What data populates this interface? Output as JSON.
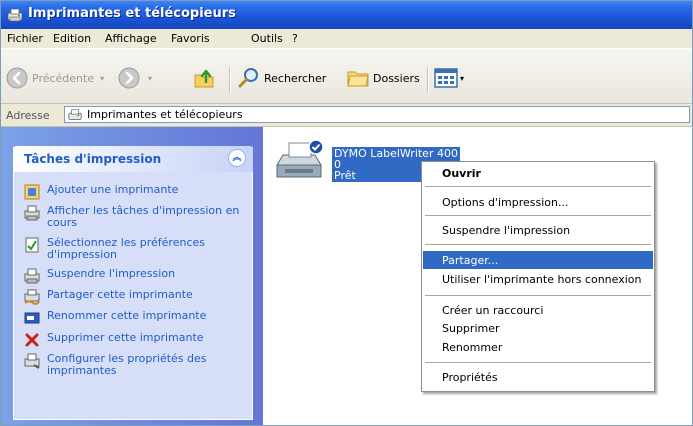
{
  "window": {
    "title": "Imprimantes et télécopieurs"
  },
  "menu": [
    "Fichier",
    "Edition",
    "Affichage",
    "Favoris",
    "Outils",
    "?"
  ],
  "toolbar": {
    "back": "Précédente",
    "search": "Rechercher",
    "folders": "Dossiers"
  },
  "address": {
    "label": "Adresse",
    "value": "Imprimantes et télécopieurs"
  },
  "tasks": {
    "title": "Tâches d'impression",
    "items": [
      {
        "label": "Ajouter une imprimante",
        "icon": "add-printer-icon"
      },
      {
        "label": "Afficher les tâches d'impression en cours",
        "icon": "print-queue-icon"
      },
      {
        "label": "Sélectionnez les préférences d'impression",
        "icon": "preferences-icon"
      },
      {
        "label": "Suspendre l'impression",
        "icon": "pause-printer-icon"
      },
      {
        "label": "Partager cette imprimante",
        "icon": "share-printer-icon"
      },
      {
        "label": "Renommer cette imprimante",
        "icon": "rename-icon"
      },
      {
        "label": "Supprimer cette imprimante",
        "icon": "delete-icon"
      },
      {
        "label": "Configurer les propriétés des imprimantes",
        "icon": "properties-icon"
      }
    ]
  },
  "printer": {
    "name": "DYMO LabelWriter 400",
    "docs": "0",
    "status": "Prêt"
  },
  "context_menu": [
    "Ouvrir",
    "Options d'impression...",
    "Suspendre l'impression",
    "Partager...",
    "Utiliser l'imprimante hors connexion",
    "Créer un raccourci",
    "Supprimer",
    "Renommer",
    "Propriétés"
  ],
  "colors": {
    "title_bar": "#1b55d6",
    "task_link": "#215dc6",
    "selection": "#316ac5",
    "pane_bg": "#6b8be0"
  }
}
